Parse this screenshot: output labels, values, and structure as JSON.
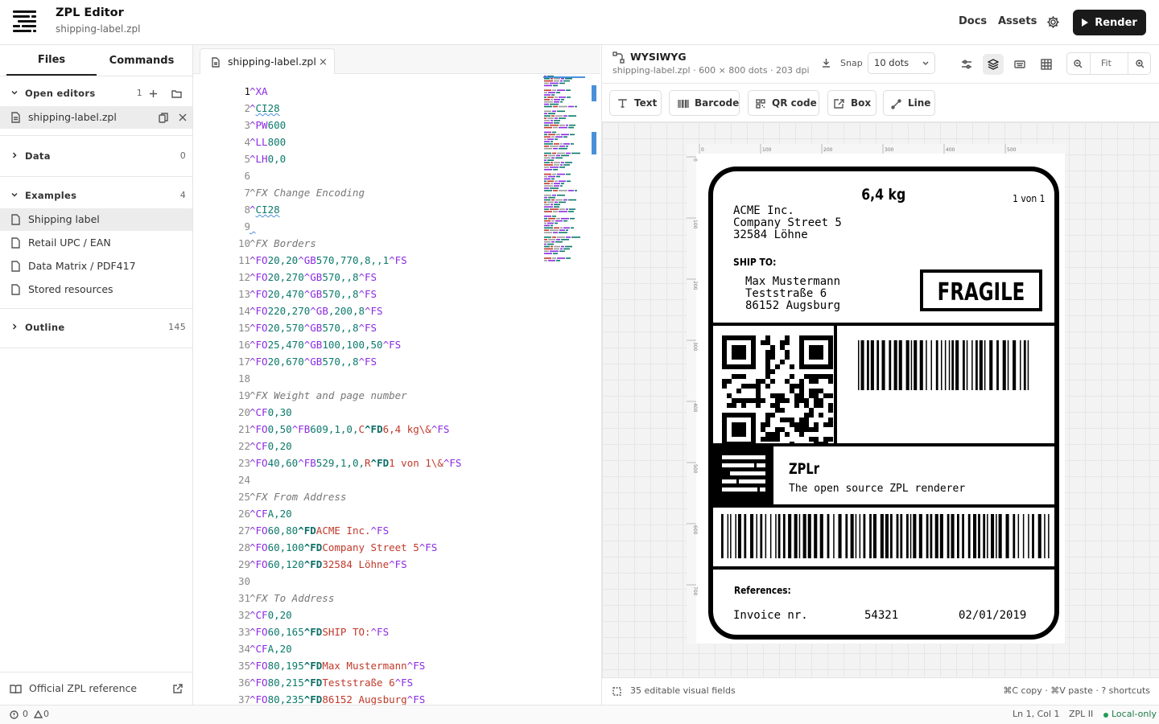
{
  "header": {
    "title": "ZPL Editor",
    "subtitle": "shipping-label.zpl",
    "nav_docs": "Docs",
    "nav_assets": "Assets",
    "render_label": "Render"
  },
  "sidebar": {
    "tabs": [
      "Files",
      "Commands"
    ],
    "open_editors": {
      "label": "Open editors",
      "count": "1",
      "file": "shipping-label.zpl"
    },
    "data": {
      "label": "Data",
      "count": "0"
    },
    "examples": {
      "label": "Examples",
      "count": "4",
      "items": [
        "Shipping label",
        "Retail UPC / EAN",
        "Data Matrix / PDF417",
        "Stored resources"
      ]
    },
    "outline": {
      "label": "Outline",
      "count": "145"
    },
    "footer_link": "Official ZPL reference"
  },
  "editor": {
    "tab_label": "shipping-label.zpl",
    "close_glyph": "×",
    "line_numbers": [
      "1",
      "2",
      "3",
      "4",
      "5",
      "6",
      "7",
      "8",
      "9",
      "10",
      "11",
      "12",
      "13",
      "14",
      "15",
      "16",
      "17",
      "18",
      "19",
      "20",
      "21",
      "22",
      "23",
      "24",
      "25",
      "26",
      "27",
      "28",
      "29",
      "30",
      "31",
      "32",
      "33",
      "34",
      "35",
      "36",
      "37"
    ],
    "lines": [
      [
        [
          "kw",
          "^XA"
        ]
      ],
      [
        [
          "kw",
          "^"
        ],
        [
          "sq",
          "CI28"
        ]
      ],
      [
        [
          "kw",
          "^PW"
        ],
        [
          "num",
          "600"
        ]
      ],
      [
        [
          "kw",
          "^LL"
        ],
        [
          "num",
          "800"
        ]
      ],
      [
        [
          "kw",
          "^LH"
        ],
        [
          "num",
          "0,0"
        ]
      ],
      [],
      [
        [
          "cm",
          "^FX Change Encoding"
        ]
      ],
      [
        [
          "kw",
          "^"
        ],
        [
          "sq",
          "CI28"
        ]
      ],
      [
        [
          "sq",
          " "
        ]
      ],
      [
        [
          "cm",
          "^FX Borders"
        ]
      ],
      [
        [
          "kw",
          "^FO"
        ],
        [
          "num",
          "20,20"
        ],
        [
          "kw",
          "^GB"
        ],
        [
          "num",
          "570,770,8,,1"
        ],
        [
          "kw",
          "^FS"
        ]
      ],
      [
        [
          "kw",
          "^FO"
        ],
        [
          "num",
          "20,270"
        ],
        [
          "kw",
          "^GB"
        ],
        [
          "num",
          "570,,8"
        ],
        [
          "kw",
          "^FS"
        ]
      ],
      [
        [
          "kw",
          "^FO"
        ],
        [
          "num",
          "20,470"
        ],
        [
          "kw",
          "^GB"
        ],
        [
          "num",
          "570,,8"
        ],
        [
          "kw",
          "^FS"
        ]
      ],
      [
        [
          "kw",
          "^FO"
        ],
        [
          "num",
          "220,270"
        ],
        [
          "kw",
          "^GB"
        ],
        [
          "num",
          ",200,8"
        ],
        [
          "kw",
          "^FS"
        ]
      ],
      [
        [
          "kw",
          "^FO"
        ],
        [
          "num",
          "20,570"
        ],
        [
          "kw",
          "^GB"
        ],
        [
          "num",
          "570,,8"
        ],
        [
          "kw",
          "^FS"
        ]
      ],
      [
        [
          "kw",
          "^FO"
        ],
        [
          "num",
          "25,470"
        ],
        [
          "kw",
          "^GB"
        ],
        [
          "num",
          "100,100,50"
        ],
        [
          "kw",
          "^FS"
        ]
      ],
      [
        [
          "kw",
          "^FO"
        ],
        [
          "num",
          "20,670"
        ],
        [
          "kw",
          "^GB"
        ],
        [
          "num",
          "570,,8"
        ],
        [
          "kw",
          "^FS"
        ]
      ],
      [],
      [
        [
          "cm",
          "^FX Weight and page number"
        ]
      ],
      [
        [
          "kw",
          "^CF"
        ],
        [
          "num",
          "0,30"
        ]
      ],
      [
        [
          "kw",
          "^FO"
        ],
        [
          "num",
          "0,50"
        ],
        [
          "kw",
          "^FB"
        ],
        [
          "num",
          "609,1,0,"
        ],
        [
          "st",
          "C"
        ],
        [
          "fd",
          "^FD"
        ],
        [
          "st",
          "6,4 kg\\&"
        ],
        [
          "kw",
          "^FS"
        ]
      ],
      [
        [
          "kw",
          "^CF"
        ],
        [
          "num",
          "0,20"
        ]
      ],
      [
        [
          "kw",
          "^FO"
        ],
        [
          "num",
          "40,60"
        ],
        [
          "kw",
          "^FB"
        ],
        [
          "num",
          "529,1,0,"
        ],
        [
          "st",
          "R"
        ],
        [
          "fd",
          "^FD"
        ],
        [
          "st",
          "1 von 1\\&"
        ],
        [
          "kw",
          "^FS"
        ]
      ],
      [],
      [
        [
          "cm",
          "^FX From Address"
        ]
      ],
      [
        [
          "kw",
          "^CF"
        ],
        [
          "num",
          "A,20"
        ]
      ],
      [
        [
          "kw",
          "^FO"
        ],
        [
          "num",
          "60,80"
        ],
        [
          "fd",
          "^FD"
        ],
        [
          "st",
          "ACME Inc."
        ],
        [
          "kw",
          "^FS"
        ]
      ],
      [
        [
          "kw",
          "^FO"
        ],
        [
          "num",
          "60,100"
        ],
        [
          "fd",
          "^FD"
        ],
        [
          "st",
          "Company Street 5"
        ],
        [
          "kw",
          "^FS"
        ]
      ],
      [
        [
          "kw",
          "^FO"
        ],
        [
          "num",
          "60,120"
        ],
        [
          "fd",
          "^FD"
        ],
        [
          "st",
          "32584 Löhne"
        ],
        [
          "kw",
          "^FS"
        ]
      ],
      [],
      [
        [
          "cm",
          "^FX To Address"
        ]
      ],
      [
        [
          "kw",
          "^CF"
        ],
        [
          "num",
          "0,20"
        ]
      ],
      [
        [
          "kw",
          "^FO"
        ],
        [
          "num",
          "60,165"
        ],
        [
          "fd",
          "^FD"
        ],
        [
          "st",
          "SHIP TO:"
        ],
        [
          "kw",
          "^FS"
        ]
      ],
      [
        [
          "kw",
          "^CF"
        ],
        [
          "num",
          "A,20"
        ]
      ],
      [
        [
          "kw",
          "^FO"
        ],
        [
          "num",
          "80,195"
        ],
        [
          "fd",
          "^FD"
        ],
        [
          "st",
          "Max Mustermann"
        ],
        [
          "kw",
          "^FS"
        ]
      ],
      [
        [
          "kw",
          "^FO"
        ],
        [
          "num",
          "80,215"
        ],
        [
          "fd",
          "^FD"
        ],
        [
          "st",
          "Teststraße 6"
        ],
        [
          "kw",
          "^FS"
        ]
      ],
      [
        [
          "kw",
          "^FO"
        ],
        [
          "num",
          "80,235"
        ],
        [
          "fd",
          "^FD"
        ],
        [
          "st",
          "86152 Augsburg"
        ],
        [
          "kw",
          "^FS"
        ]
      ]
    ]
  },
  "preview": {
    "title": "WYSIWYG",
    "subtitle": "shipping-label.zpl · 600 × 800 dots · 203 dpi",
    "snap_label": "Snap",
    "snap_value": "10 dots",
    "zoom_label": "Fit",
    "tools": [
      "Text",
      "Barcode",
      "QR code",
      "Box",
      "Line"
    ],
    "footer_fields": "35 editable visual fields",
    "footer_shortcuts": "⌘C copy · ⌘V paste · ? shortcuts",
    "ruler_top": [
      "0",
      "100",
      "200",
      "300",
      "400",
      "500"
    ],
    "ruler_left": [
      "0",
      "100",
      "200",
      "300",
      "400",
      "500",
      "600",
      "700"
    ]
  },
  "label": {
    "weight": "6,4 kg",
    "page": "1 von 1",
    "from": [
      "ACME Inc.",
      "Company Street 5",
      "32584 Löhne"
    ],
    "ship_to_label": "SHIP TO:",
    "to": [
      "Max Mustermann",
      "Teststraße 6",
      "86152 Augsburg"
    ],
    "fragile": "FRAGILE",
    "brand": "ZPLr",
    "tagline": "The open source ZPL renderer",
    "references_label": "References:",
    "invoice_label": "Invoice nr.",
    "invoice_number": "54321",
    "date": "02/01/2019"
  },
  "status": {
    "errors": "0",
    "warnings": "0",
    "cursor": "Ln 1, Col 1",
    "language": "ZPL II",
    "mode": "Local-only"
  },
  "colors": {
    "accent": "#4a90d9",
    "keyword": "#8a2be2",
    "string": "#c0392b",
    "comment": "#777777",
    "local_dot": "#1f9d55"
  }
}
